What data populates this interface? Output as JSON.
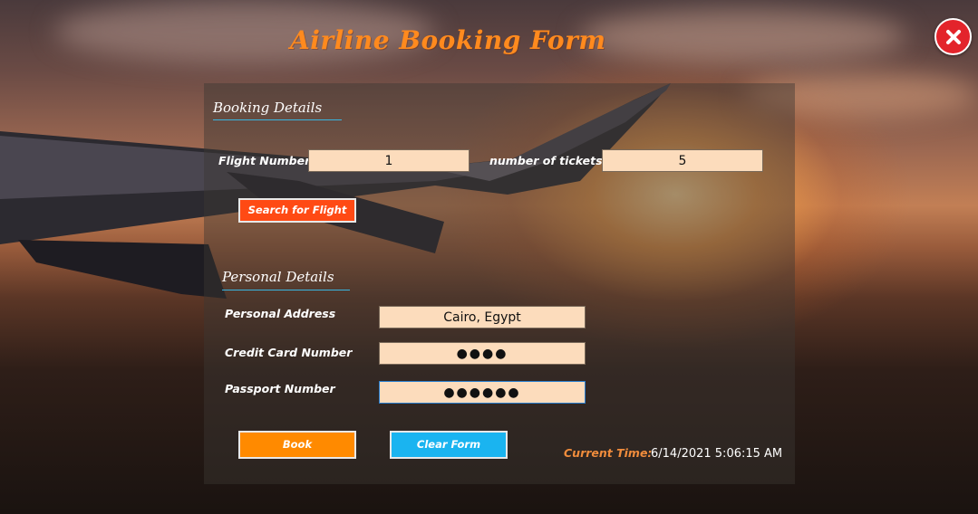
{
  "window": {
    "title": "Airline Booking Form",
    "close_icon": "close-x-icon"
  },
  "booking": {
    "section_title": "Booking Details",
    "flight_number_label": "Flight Number",
    "flight_number_value": "1",
    "tickets_label": "number of tickets",
    "tickets_value": "5",
    "search_button": "Search for Flight"
  },
  "personal": {
    "section_title": "Personal Details",
    "address_label": "Personal Address",
    "address_value": "Cairo, Egypt",
    "card_label": "Credit Card Number",
    "card_value": "●●●●",
    "passport_label": "Passport Number",
    "passport_value": "●●●●●●"
  },
  "actions": {
    "book_button": "Book",
    "clear_button": "Clear Form"
  },
  "status": {
    "time_label": "Current Time:",
    "time_value": "6/14/2021 5:06:15 AM"
  },
  "colors": {
    "title": "#ff8a1e",
    "search_button": "#ff4a14",
    "book_button": "#ff8a00",
    "clear_button": "#1ab4f0",
    "field_bg": "#fcdcbc",
    "underline": "#38b6e0"
  }
}
